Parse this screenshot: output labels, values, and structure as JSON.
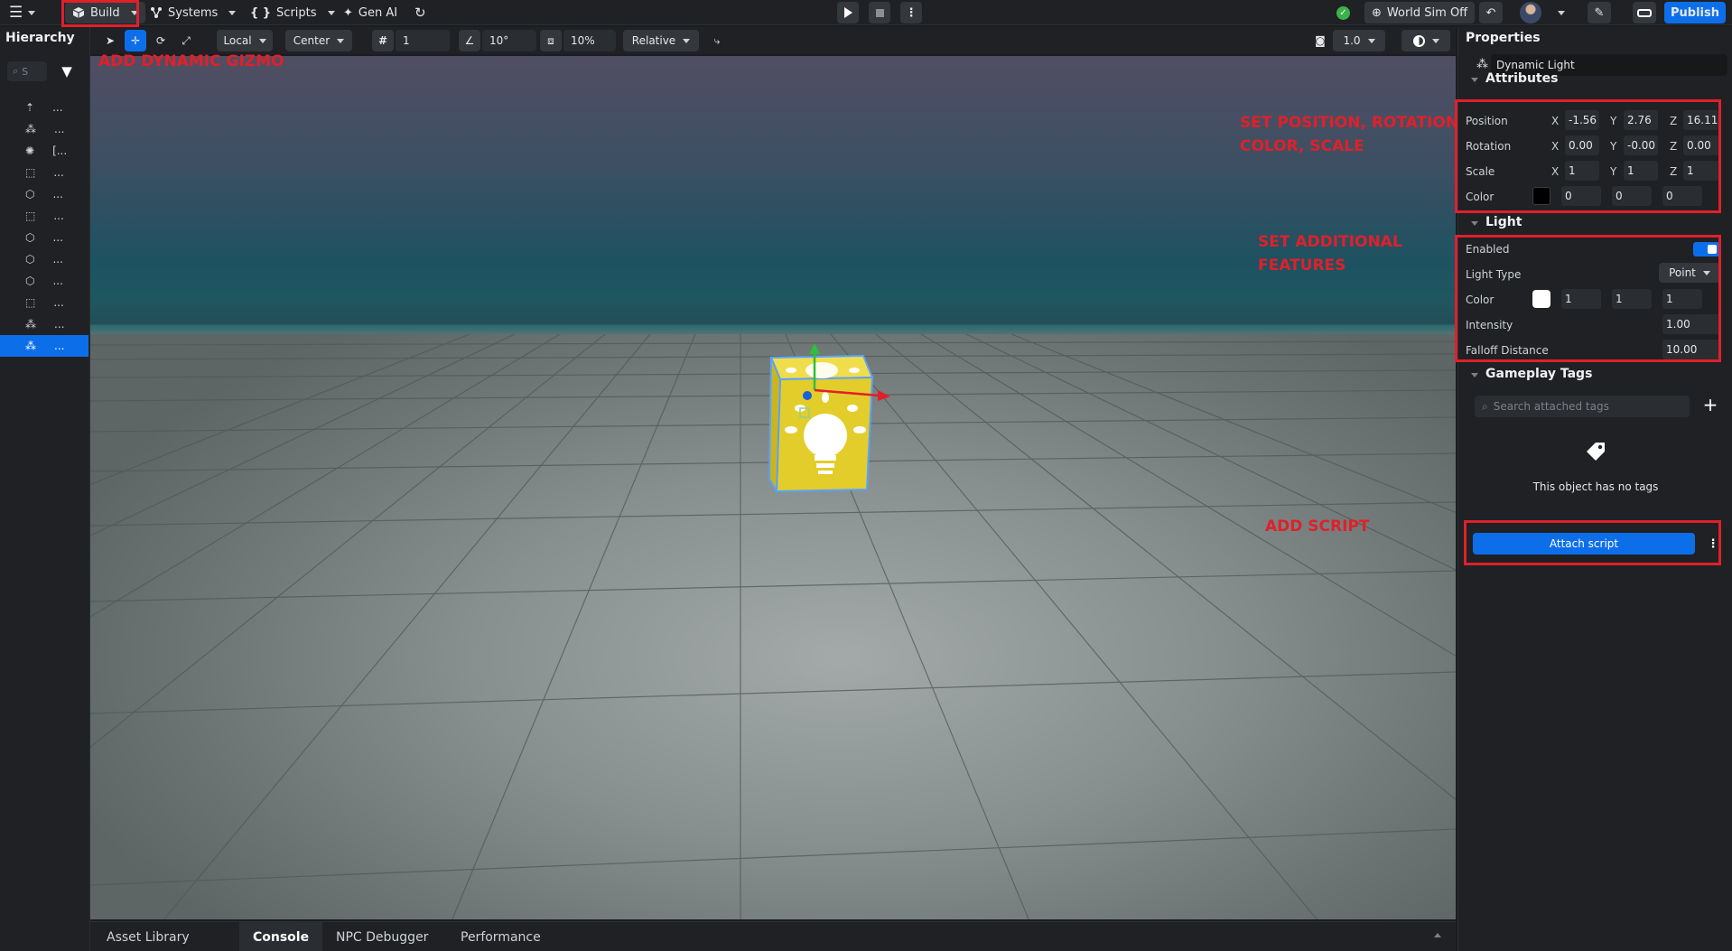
{
  "topbar": {
    "build_label": "Build",
    "systems_label": "Systems",
    "scripts_label": "Scripts",
    "genai_label": "Gen AI",
    "world_sim_label": "World Sim Off",
    "publish_label": "Publish"
  },
  "toolbar": {
    "space_value": "Local",
    "pivot_value": "Center",
    "grid_snap": "1",
    "rotation_snap": "10°",
    "scale_snap": "10%",
    "mode_value": "Relative",
    "camera_speed": "1.0"
  },
  "hierarchy": {
    "title": "Hierarchy",
    "search_placeholder": "S",
    "items": [
      {
        "label": "..."
      },
      {
        "label": "..."
      },
      {
        "label": "[..."
      },
      {
        "label": "..."
      },
      {
        "label": "..."
      },
      {
        "label": "..."
      },
      {
        "label": "..."
      },
      {
        "label": "..."
      },
      {
        "label": "..."
      },
      {
        "label": "..."
      },
      {
        "label": "..."
      },
      {
        "label": "..."
      }
    ]
  },
  "annotations": {
    "gizmo": "ADD DYNAMIC GIZMO",
    "attributes_line1": "SET POSITION, ROTATION",
    "attributes_line2": "COLOR, SCALE",
    "light_line1": "SET ADDITIONAL",
    "light_line2": "FEATURES",
    "script": "ADD SCRIPT"
  },
  "properties": {
    "title": "Properties",
    "object_name": "Dynamic Light",
    "attributes": {
      "title": "Attributes",
      "position_label": "Position",
      "rotation_label": "Rotation",
      "scale_label": "Scale",
      "color_label": "Color",
      "x": "X",
      "y": "Y",
      "z": "Z",
      "position": {
        "x": "-1.56",
        "y": "2.76",
        "z": "16.11"
      },
      "rotation": {
        "x": "0.00",
        "y": "-0.00",
        "z": "0.00"
      },
      "scale": {
        "x": "1",
        "y": "1",
        "z": "1"
      },
      "color": {
        "r": "0",
        "g": "0",
        "b": "0",
        "swatch": "#000000"
      }
    },
    "light": {
      "title": "Light",
      "enabled_label": "Enabled",
      "enabled": true,
      "type_label": "Light Type",
      "type_value": "Point",
      "color_label": "Color",
      "color": {
        "r": "1",
        "g": "1",
        "b": "1",
        "swatch": "#ffffff"
      },
      "intensity_label": "Intensity",
      "intensity": "1.00",
      "falloff_label": "Falloff Distance",
      "falloff": "10.00"
    },
    "tags": {
      "title": "Gameplay Tags",
      "search_placeholder": "Search attached tags",
      "empty_text": "This object has no tags"
    },
    "attach_script_label": "Attach script"
  },
  "bottom_tabs": [
    {
      "label": "Asset Library"
    },
    {
      "label": "Console"
    },
    {
      "label": "NPC Debugger"
    },
    {
      "label": "Performance"
    }
  ],
  "colors": {
    "accent": "#0d6eea",
    "annotation": "#e0202a",
    "cube": "#e3cd2a"
  }
}
